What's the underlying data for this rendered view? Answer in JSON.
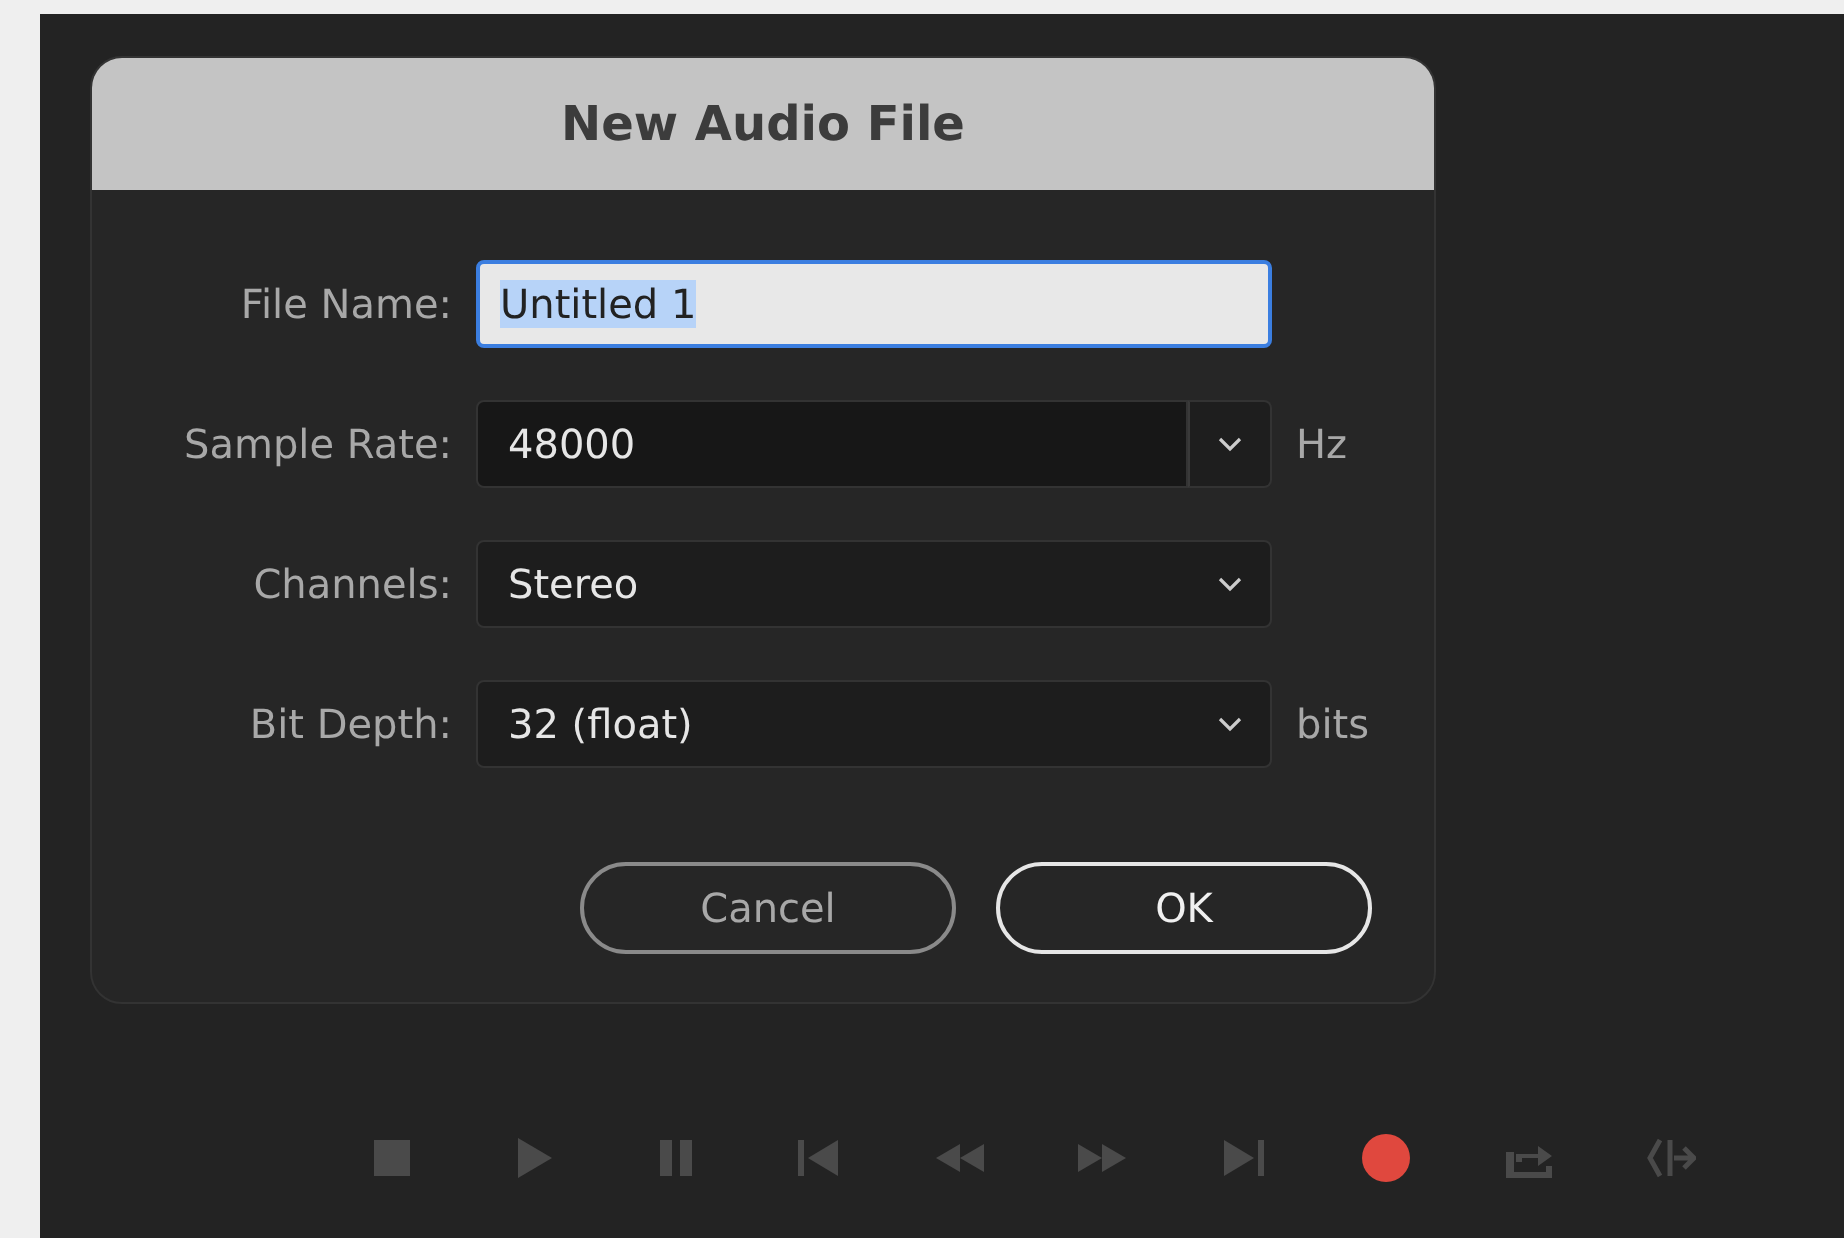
{
  "dialog": {
    "title": "New Audio File",
    "fields": [
      {
        "kind": "text",
        "label": "File Name:",
        "value": "Untitled 1",
        "selected": true
      },
      {
        "kind": "combo",
        "label": "Sample Rate:",
        "value": "48000",
        "unit": "Hz"
      },
      {
        "kind": "dropdown",
        "label": "Channels:",
        "value": "Stereo"
      },
      {
        "kind": "dropdown",
        "label": "Bit Depth:",
        "value": "32 (float)",
        "unit": "bits"
      }
    ],
    "buttons": [
      {
        "label": "Cancel",
        "default": false
      },
      {
        "label": "OK",
        "default": true
      }
    ]
  }
}
